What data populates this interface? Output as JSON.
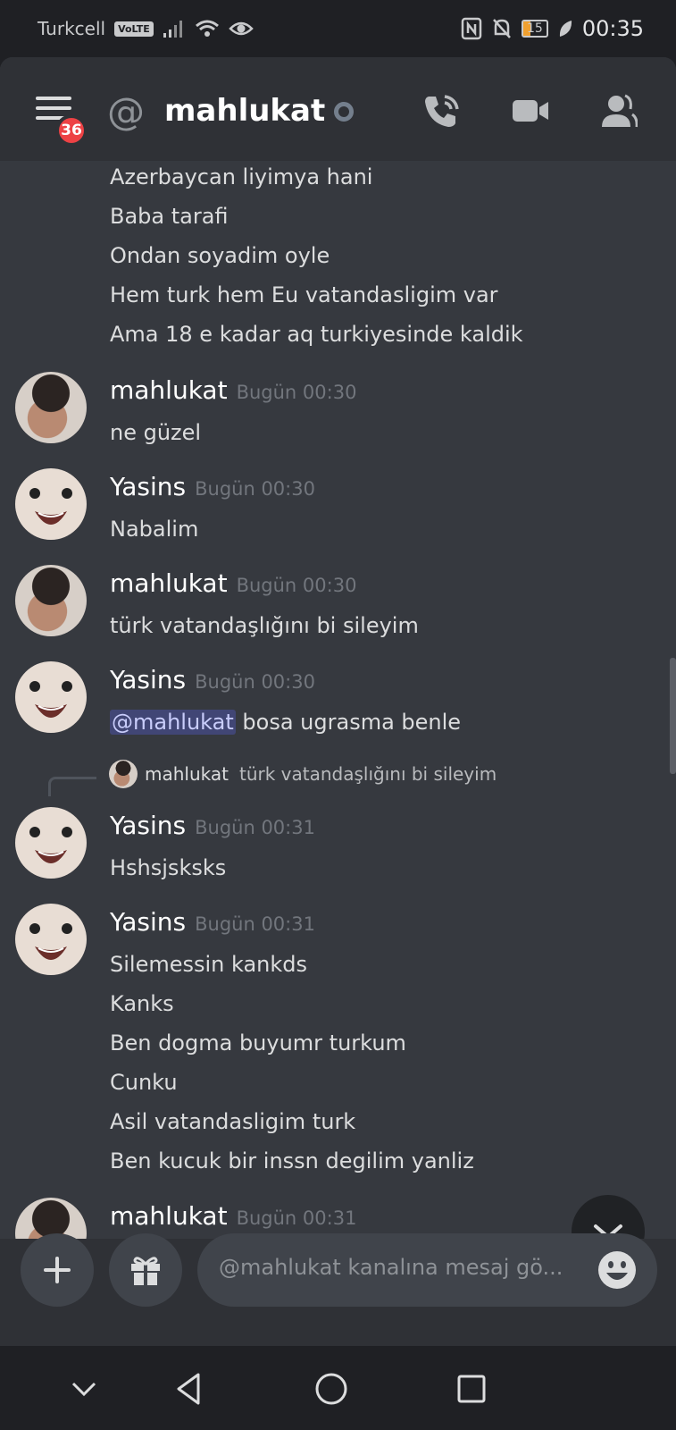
{
  "status_bar": {
    "carrier": "Turkcell",
    "volte": "VoLTE",
    "battery": "15",
    "time": "00:35"
  },
  "header": {
    "notification_count": "36",
    "at_symbol": "@",
    "channel_title": "mahlukat"
  },
  "messages": {
    "continued_lines": [
      "Azerbaycan liyimya hani",
      "Baba tarafi",
      "Ondan soyadim oyle",
      "Hem turk hem Eu vatandasligim var",
      "Ama 18 e kadar aq turkiyesinde kaldik"
    ],
    "m1": {
      "author": "mahlukat",
      "time": "Bugün 00:30",
      "lines": [
        "ne güzel"
      ]
    },
    "m2": {
      "author": "Yasins",
      "time": "Bugün 00:30",
      "lines": [
        "Nabalim"
      ]
    },
    "m3": {
      "author": "mahlukat",
      "time": "Bugün 00:30",
      "lines": [
        "türk vatandaşlığını bi sileyim"
      ]
    },
    "m4": {
      "author": "Yasins",
      "time": "Bugün 00:30",
      "mention": "@mahlukat",
      "rest": " bosa ugrasma benle"
    },
    "reply": {
      "author": "mahlukat",
      "text": "türk vatandaşlığını bi sileyim"
    },
    "m5": {
      "author": "Yasins",
      "time": "Bugün 00:31",
      "lines": [
        "Hshsjsksks"
      ]
    },
    "m6": {
      "author": "Yasins",
      "time": "Bugün 00:31",
      "lines": [
        "Silemessin kankds",
        "Kanks",
        "Ben dogma buyumr turkum",
        "Cunku",
        "Asil vatandasligim turk",
        "Ben kucuk bir inssn degilim yanliz"
      ]
    },
    "m7": {
      "author": "mahlukat",
      "time": "Bugün 00:31"
    }
  },
  "composer": {
    "placeholder": "@mahlukat kanalına mesaj gö..."
  },
  "colors": {
    "background": "#36393f",
    "header": "#2f3136",
    "badge": "#ed4245",
    "mention_bg": "#414675"
  }
}
